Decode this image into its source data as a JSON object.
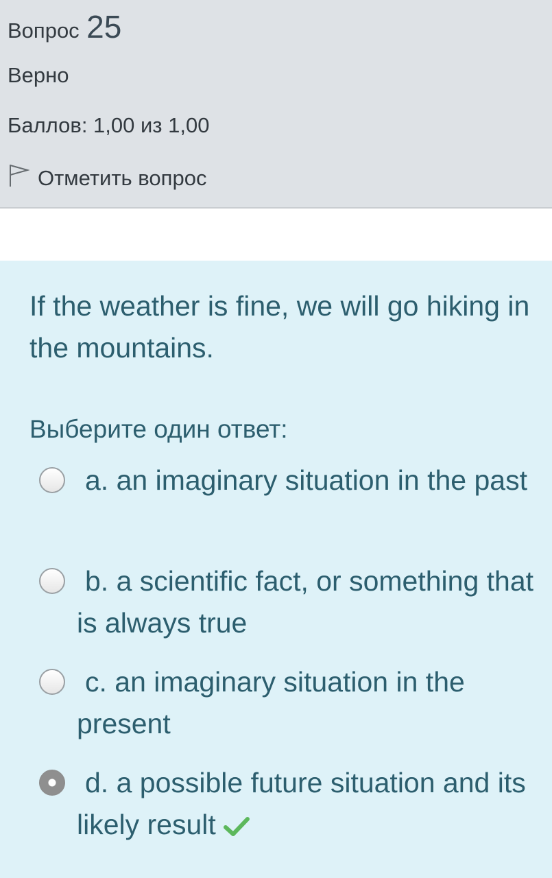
{
  "info": {
    "question_label": "Вопрос",
    "question_number": "25",
    "state": "Верно",
    "grade": "Баллов: 1,00 из 1,00",
    "flag_label": "Отметить вопрос"
  },
  "question": {
    "text": "If the weather is fine, we will go hiking in the mountains.",
    "prompt": "Выберите один ответ:"
  },
  "options": [
    {
      "text": "a. an imaginary situation in the past",
      "selected": false
    },
    {
      "text": "b. a scientific fact, or something that is always true",
      "selected": false
    },
    {
      "text": "c. an imaginary situation in the present",
      "selected": false
    },
    {
      "text": "d. a possible future situation and its likely result",
      "selected": true,
      "correct_icon": "check-icon"
    }
  ],
  "colors": {
    "info_bg": "#dee2e6",
    "content_bg": "#def2f8",
    "text": "#2c5e6e",
    "correct": "#5cb85c"
  }
}
